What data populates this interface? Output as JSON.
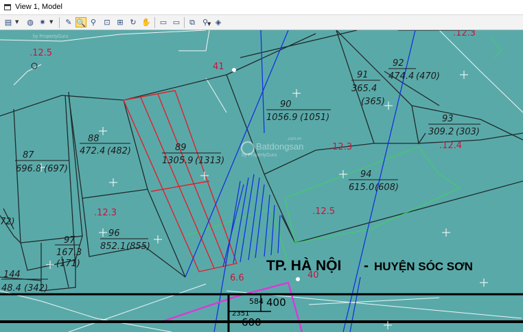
{
  "window": {
    "title": "View 1, Model"
  },
  "toolbar": {
    "buttons": [
      {
        "name": "view-attributes",
        "glyph": "▤",
        "dropdown": true
      },
      {
        "name": "display-style",
        "glyph": "◍",
        "dropdown": false
      },
      {
        "name": "lighting",
        "glyph": "✷",
        "dropdown": true
      },
      {
        "name": "pen",
        "glyph": "✎",
        "dropdown": false
      },
      {
        "name": "zoom-in",
        "glyph": "🔍",
        "dropdown": false,
        "active": true
      },
      {
        "name": "zoom-out",
        "glyph": "⚲",
        "dropdown": false
      },
      {
        "name": "window-area",
        "glyph": "⊡",
        "dropdown": false
      },
      {
        "name": "fit-view",
        "glyph": "⊞",
        "dropdown": false
      },
      {
        "name": "rotate-view",
        "glyph": "↻",
        "dropdown": false
      },
      {
        "name": "pan-view",
        "glyph": "✋",
        "dropdown": false
      },
      {
        "name": "view-previous",
        "glyph": "▭",
        "dropdown": false
      },
      {
        "name": "view-next",
        "glyph": "▭",
        "dropdown": false
      },
      {
        "name": "copy-view",
        "glyph": "⧉",
        "dropdown": false
      },
      {
        "name": "view-camera",
        "glyph": "⚲",
        "dropdown": true
      },
      {
        "name": "clip-volume",
        "glyph": "◈",
        "dropdown": false
      }
    ]
  },
  "map": {
    "parcels": [
      {
        "id": "87",
        "area": "696.8",
        "legal": "(697)"
      },
      {
        "id": "88",
        "area": "472.4",
        "legal": "(482)"
      },
      {
        "id": "89",
        "area": "1305.9",
        "legal": "(1313)"
      },
      {
        "id": "90",
        "area": "1056.9",
        "legal": "(1051)"
      },
      {
        "id": "91",
        "area": "365.4",
        "legal": "(365)"
      },
      {
        "id": "92",
        "area": "474.4",
        "legal": "(470)"
      },
      {
        "id": "93",
        "area": "309.2",
        "legal": "(303)"
      },
      {
        "id": "94",
        "area": "615.0",
        "legal": "(608)"
      },
      {
        "id": "96",
        "area": "852.1",
        "legal": "(855)"
      },
      {
        "id": "97",
        "area": "167.3",
        "legal": "(171)"
      },
      {
        "id": "144",
        "area": "48.4",
        "legal": "(342)"
      }
    ],
    "partial_labels": [
      "72)"
    ],
    "elevations": [
      ".12.5",
      ".12.3",
      ".12.4",
      ".12.3",
      ".12.5",
      ".12.3",
      "6.6"
    ],
    "points": [
      "41",
      "40"
    ],
    "region_label": "TP. HÀ NỘI",
    "region_dash": "-",
    "district_label": "HUYỆN SÓC SƠN",
    "sheet_numbers": [
      "584",
      "400",
      "2351",
      "600"
    ],
    "watermarks": [
      {
        "brand": "Batdongsan",
        "sub": "by PropertyGuru",
        "domain": ".com.vn"
      },
      {
        "sub": "by PropertyGuru"
      }
    ],
    "colors": {
      "background": "#5aa9a9",
      "boundary": "#1f2b2b",
      "highlight": "#e0202a",
      "river_lines": "#1133dd",
      "green_line": "#3fd060",
      "magenta_line": "#d63cd6",
      "frame": "#000000"
    }
  }
}
